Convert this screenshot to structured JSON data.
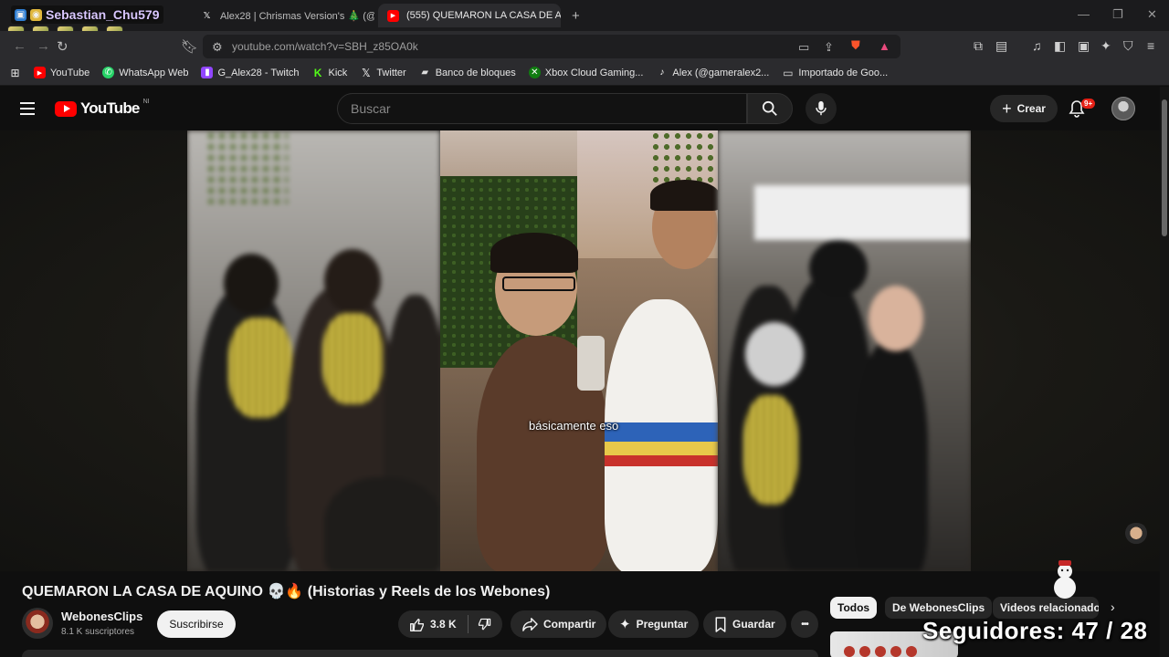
{
  "browser": {
    "tabs": [
      {
        "label": "Alex28 | Chrismas Version's 🎄 (@Ga"
      },
      {
        "label": "(555) QUEMARON LA CASA DE A"
      }
    ],
    "new_tab_glyph": "+",
    "url": "youtube.com/watch?v=SBH_z85OA0k",
    "bookmarks": [
      {
        "label": "YouTube",
        "icon": "youtube-icon",
        "color": "#ff0000"
      },
      {
        "label": "WhatsApp Web",
        "icon": "whatsapp-icon",
        "color": "#25d366"
      },
      {
        "label": "G_Alex28 - Twitch",
        "icon": "twitch-icon",
        "color": "#9146ff"
      },
      {
        "label": "Kick",
        "icon": "kick-icon",
        "color": "#53fc18"
      },
      {
        "label": "Twitter",
        "icon": "x-icon",
        "color": "#ffffff"
      },
      {
        "label": "Banco de bloques",
        "icon": "block-icon",
        "color": "#dddddd"
      },
      {
        "label": "Xbox Cloud Gaming...",
        "icon": "xbox-icon",
        "color": "#107c10"
      },
      {
        "label": "Alex (@gameralex2...",
        "icon": "tiktok-icon",
        "color": "#ffffff"
      },
      {
        "label": "Importado de Goo...",
        "icon": "folder-icon",
        "color": "#dddddd"
      }
    ]
  },
  "stream_overlay": {
    "streamer_name": "Sebastian_Chu579",
    "followers_text": "Seguidores: 47 / 28"
  },
  "youtube": {
    "logo_text": "YouTube",
    "region": "NI",
    "search_placeholder": "Buscar",
    "create_label": "Crear",
    "notification_count": "9+",
    "video": {
      "subtitle": "básicamente eso",
      "title": "QUEMARON LA CASA DE AQUINO 💀🔥 (Historias y Reels de los Webones)"
    },
    "channel": {
      "name": "WebonesClips",
      "subscribers": "8.1 K suscriptores",
      "subscribe_label": "Suscribirse"
    },
    "actions": {
      "likes": "3.8 K",
      "share": "Compartir",
      "ask": "Preguntar",
      "save": "Guardar",
      "more": "•••"
    },
    "chips": [
      "Todos",
      "De WebonesClips",
      "Videos relacionados"
    ]
  },
  "colors": {
    "accent": "#ff0000",
    "background": "#0f0f0f",
    "chip_selected": "#f1f1f1"
  }
}
